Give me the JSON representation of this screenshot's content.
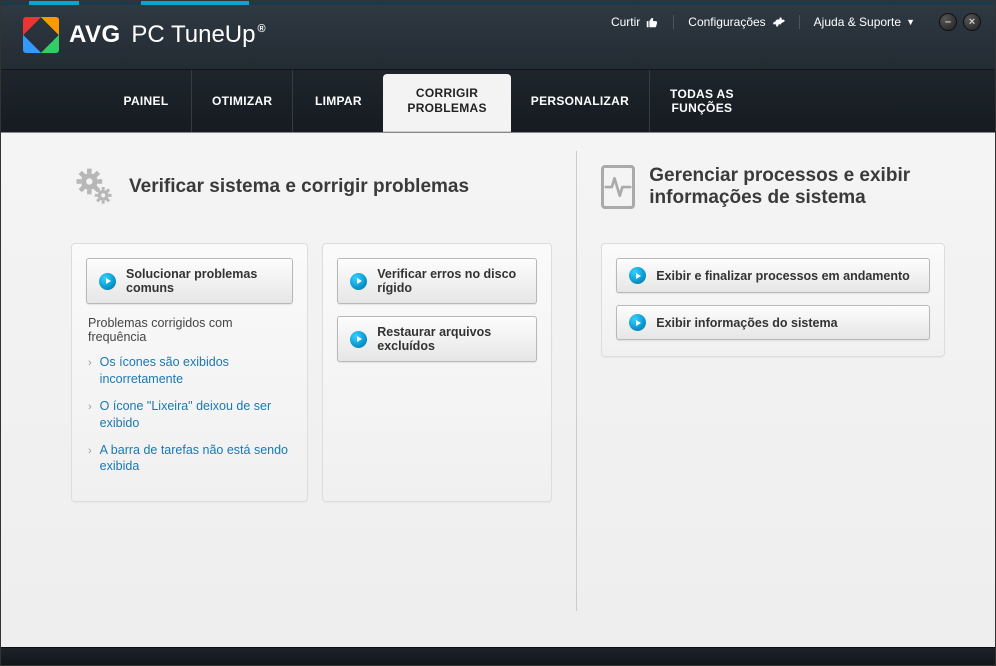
{
  "brand": {
    "name1": "AVG",
    "name2": "PC TuneUp",
    "reg": "®"
  },
  "header": {
    "like": "Curtir",
    "settings": "Configurações",
    "help": "Ajuda & Suporte"
  },
  "nav": {
    "painel": "PAINEL",
    "otimizar": "OTIMIZAR",
    "limpar": "LIMPAR",
    "corrigir": "CORRIGIR\nPROBLEMAS",
    "personalizar": "PERSONALIZAR",
    "todas": "TODAS AS\nFUNÇÕES"
  },
  "left": {
    "title": "Verificar sistema e corrigir problemas",
    "btn_common": "Solucionar problemas comuns",
    "freq_title": "Problemas corrigidos com frequência",
    "freq": [
      "Os ícones são exibidos incorretamente",
      "O ícone \"Lixeira\" deixou de ser exibido",
      "A barra de tarefas não está sendo exibida"
    ],
    "btn_disk": "Verificar erros no disco rígido",
    "btn_restore": "Restaurar arquivos excluídos"
  },
  "right": {
    "title": "Gerenciar processos e exibir informações de sistema",
    "btn_proc": "Exibir e finalizar processos em andamento",
    "btn_info": "Exibir informações do sistema"
  }
}
